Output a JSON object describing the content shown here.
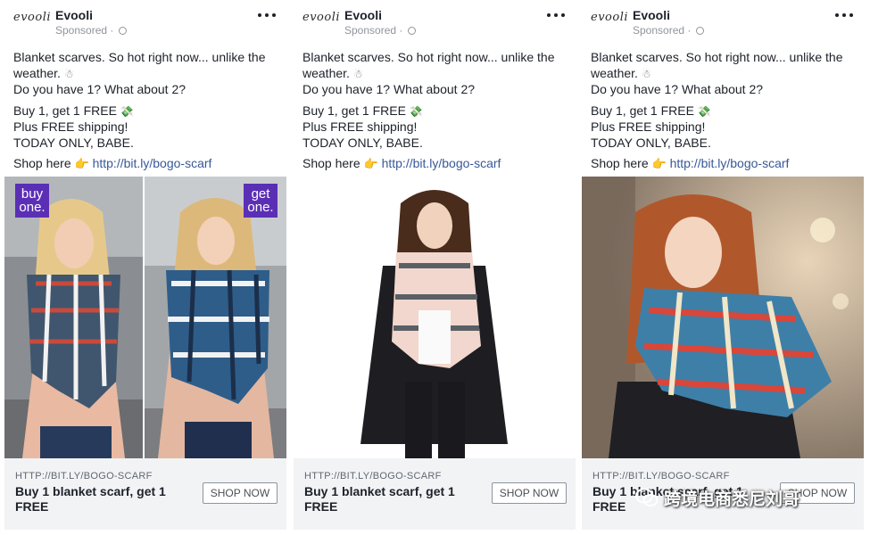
{
  "ads": [
    {
      "brand": "Evooli",
      "logo_text": "evooli",
      "sponsored": "Sponsored ·",
      "text_lines": [
        "Blanket scarves. So hot right now... unlike the",
        "weather.",
        "Do you have 1? What about 2?",
        "Buy 1, get 1 FREE",
        "Plus FREE shipping!",
        "TODAY ONLY, BABE.",
        "Shop here"
      ],
      "emoji_snowman": "☃",
      "emoji_money": "💸",
      "emoji_hand": "👉",
      "link": "http://bit.ly/bogo-scarf",
      "tags": [
        "buy one.",
        "get one."
      ],
      "footer_url": "HTTP://BIT.LY/BOGO-SCARF",
      "headline": "Buy 1 blanket scarf, get 1 FREE",
      "cta": "SHOP NOW"
    },
    {
      "brand": "Evooli",
      "logo_text": "evooli",
      "sponsored": "Sponsored ·",
      "text_lines": [
        "Blanket scarves. So hot right now... unlike the",
        "weather.",
        "Do you have 1? What about 2?",
        "Buy 1, get 1 FREE",
        "Plus FREE shipping!",
        "TODAY ONLY, BABE.",
        "Shop here"
      ],
      "emoji_snowman": "☃",
      "emoji_money": "💸",
      "emoji_hand": "👉",
      "link": "http://bit.ly/bogo-scarf",
      "footer_url": "HTTP://BIT.LY/BOGO-SCARF",
      "headline": "Buy 1 blanket scarf, get 1 FREE",
      "cta": "SHOP NOW"
    },
    {
      "brand": "Evooli",
      "logo_text": "evooli",
      "sponsored": "Sponsored ·",
      "text_lines": [
        "Blanket scarves. So hot right now... unlike the",
        "weather.",
        "Do you have 1? What about 2?",
        "Buy 1, get 1 FREE",
        "Plus FREE shipping!",
        "TODAY ONLY, BABE.",
        "Shop here"
      ],
      "emoji_snowman": "☃",
      "emoji_money": "💸",
      "emoji_hand": "👉",
      "link": "http://bit.ly/bogo-scarf",
      "footer_url": "HTTP://BIT.LY/BOGO-SCARF",
      "headline": "Buy 1 blanket scarf, get 1 FREE",
      "cta": "SHOP NOW"
    }
  ],
  "watermark": "跨境电商悉尼刘哥",
  "colors": {
    "link": "#385898",
    "tag_bg": "#5b2fb5",
    "footer_bg": "#f2f3f5",
    "secondary_text": "#90949c"
  }
}
